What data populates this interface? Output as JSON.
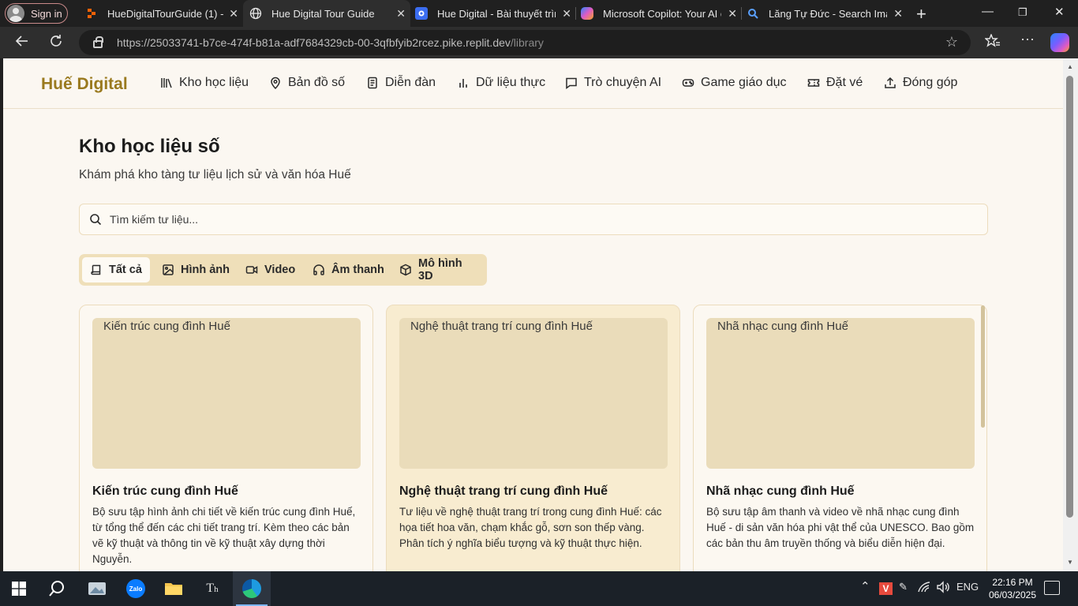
{
  "browser": {
    "profile_label": "Sign in",
    "tabs": [
      {
        "title": "HueDigitalTourGuide (1) - Re",
        "icon": "replit-icon"
      },
      {
        "title": "Hue Digital Tour Guide",
        "icon": "globe-icon",
        "active": true
      },
      {
        "title": "Hue Digital - Bài thuyết trình",
        "icon": "presentation-icon"
      },
      {
        "title": "Microsoft Copilot: Your AI co",
        "icon": "copilot-icon"
      },
      {
        "title": "Lăng Tự Đức - Search Image",
        "icon": "search-icon"
      }
    ],
    "url_host": "https://25033741-b7ce-474f-b81a-adf7684329cb-00-3qfbfyib2rcez.pike.replit.dev",
    "url_path": "/library"
  },
  "site": {
    "brand": "Huế Digital",
    "nav": [
      {
        "label": "Kho học liệu",
        "icon": "library-icon"
      },
      {
        "label": "Bản đồ số",
        "icon": "map-pin-icon"
      },
      {
        "label": "Diễn đàn",
        "icon": "forum-icon"
      },
      {
        "label": "Dữ liệu thực",
        "icon": "bar-chart-icon"
      },
      {
        "label": "Trò chuyện AI",
        "icon": "chat-icon"
      },
      {
        "label": "Game giáo dục",
        "icon": "gamepad-icon"
      },
      {
        "label": "Đặt vé",
        "icon": "ticket-icon"
      },
      {
        "label": "Đóng góp",
        "icon": "upload-icon"
      }
    ]
  },
  "library": {
    "title": "Kho học liệu số",
    "subtitle": "Khám phá kho tàng tư liệu lịch sử và văn hóa Huế",
    "search_placeholder": "Tìm kiếm tư liệu...",
    "filters": [
      {
        "label": "Tất cả",
        "icon": "book-icon",
        "active": true
      },
      {
        "label": "Hình ảnh",
        "icon": "image-icon"
      },
      {
        "label": "Video",
        "icon": "video-icon"
      },
      {
        "label": "Âm thanh",
        "icon": "headphones-icon"
      },
      {
        "label": "Mô hình 3D",
        "icon": "cube-icon"
      }
    ],
    "cards": [
      {
        "image_alt": "Kiến trúc cung đình Huế",
        "title": "Kiến trúc cung đình Huế",
        "description": "Bộ sưu tập hình ảnh chi tiết về kiến trúc cung đình Huế, từ tổng thể đến các chi tiết trang trí. Kèm theo các bản vẽ kỹ thuật và thông tin về kỹ thuật xây dựng thời Nguyễn."
      },
      {
        "image_alt": "Nghệ thuật trang trí cung đình Huế",
        "title": "Nghệ thuật trang trí cung đình Huế",
        "description": "Tư liệu về nghệ thuật trang trí trong cung đình Huế: các họa tiết hoa văn, chạm khắc gỗ, sơn son thếp vàng. Phân tích ý nghĩa biểu tượng và kỹ thuật thực hiện."
      },
      {
        "image_alt": "Nhã nhạc cung đình Huế",
        "title": "Nhã nhạc cung đình Huế",
        "description": "Bộ sưu tập âm thanh và video về nhã nhạc cung đình Huế - di sản văn hóa phi vật thể của UNESCO. Bao gồm các bản thu âm truyền thống và biểu diễn hiện đại."
      }
    ]
  },
  "taskbar": {
    "language": "ENG",
    "time": "22:16 PM",
    "date": "06/03/2025"
  },
  "colors": {
    "brand": "#9a7a1f",
    "page_bg": "#fbf7f1",
    "filter_bg": "#efdfb9",
    "card_highlight": "#f8ecd0",
    "image_placeholder": "#eadcba"
  }
}
